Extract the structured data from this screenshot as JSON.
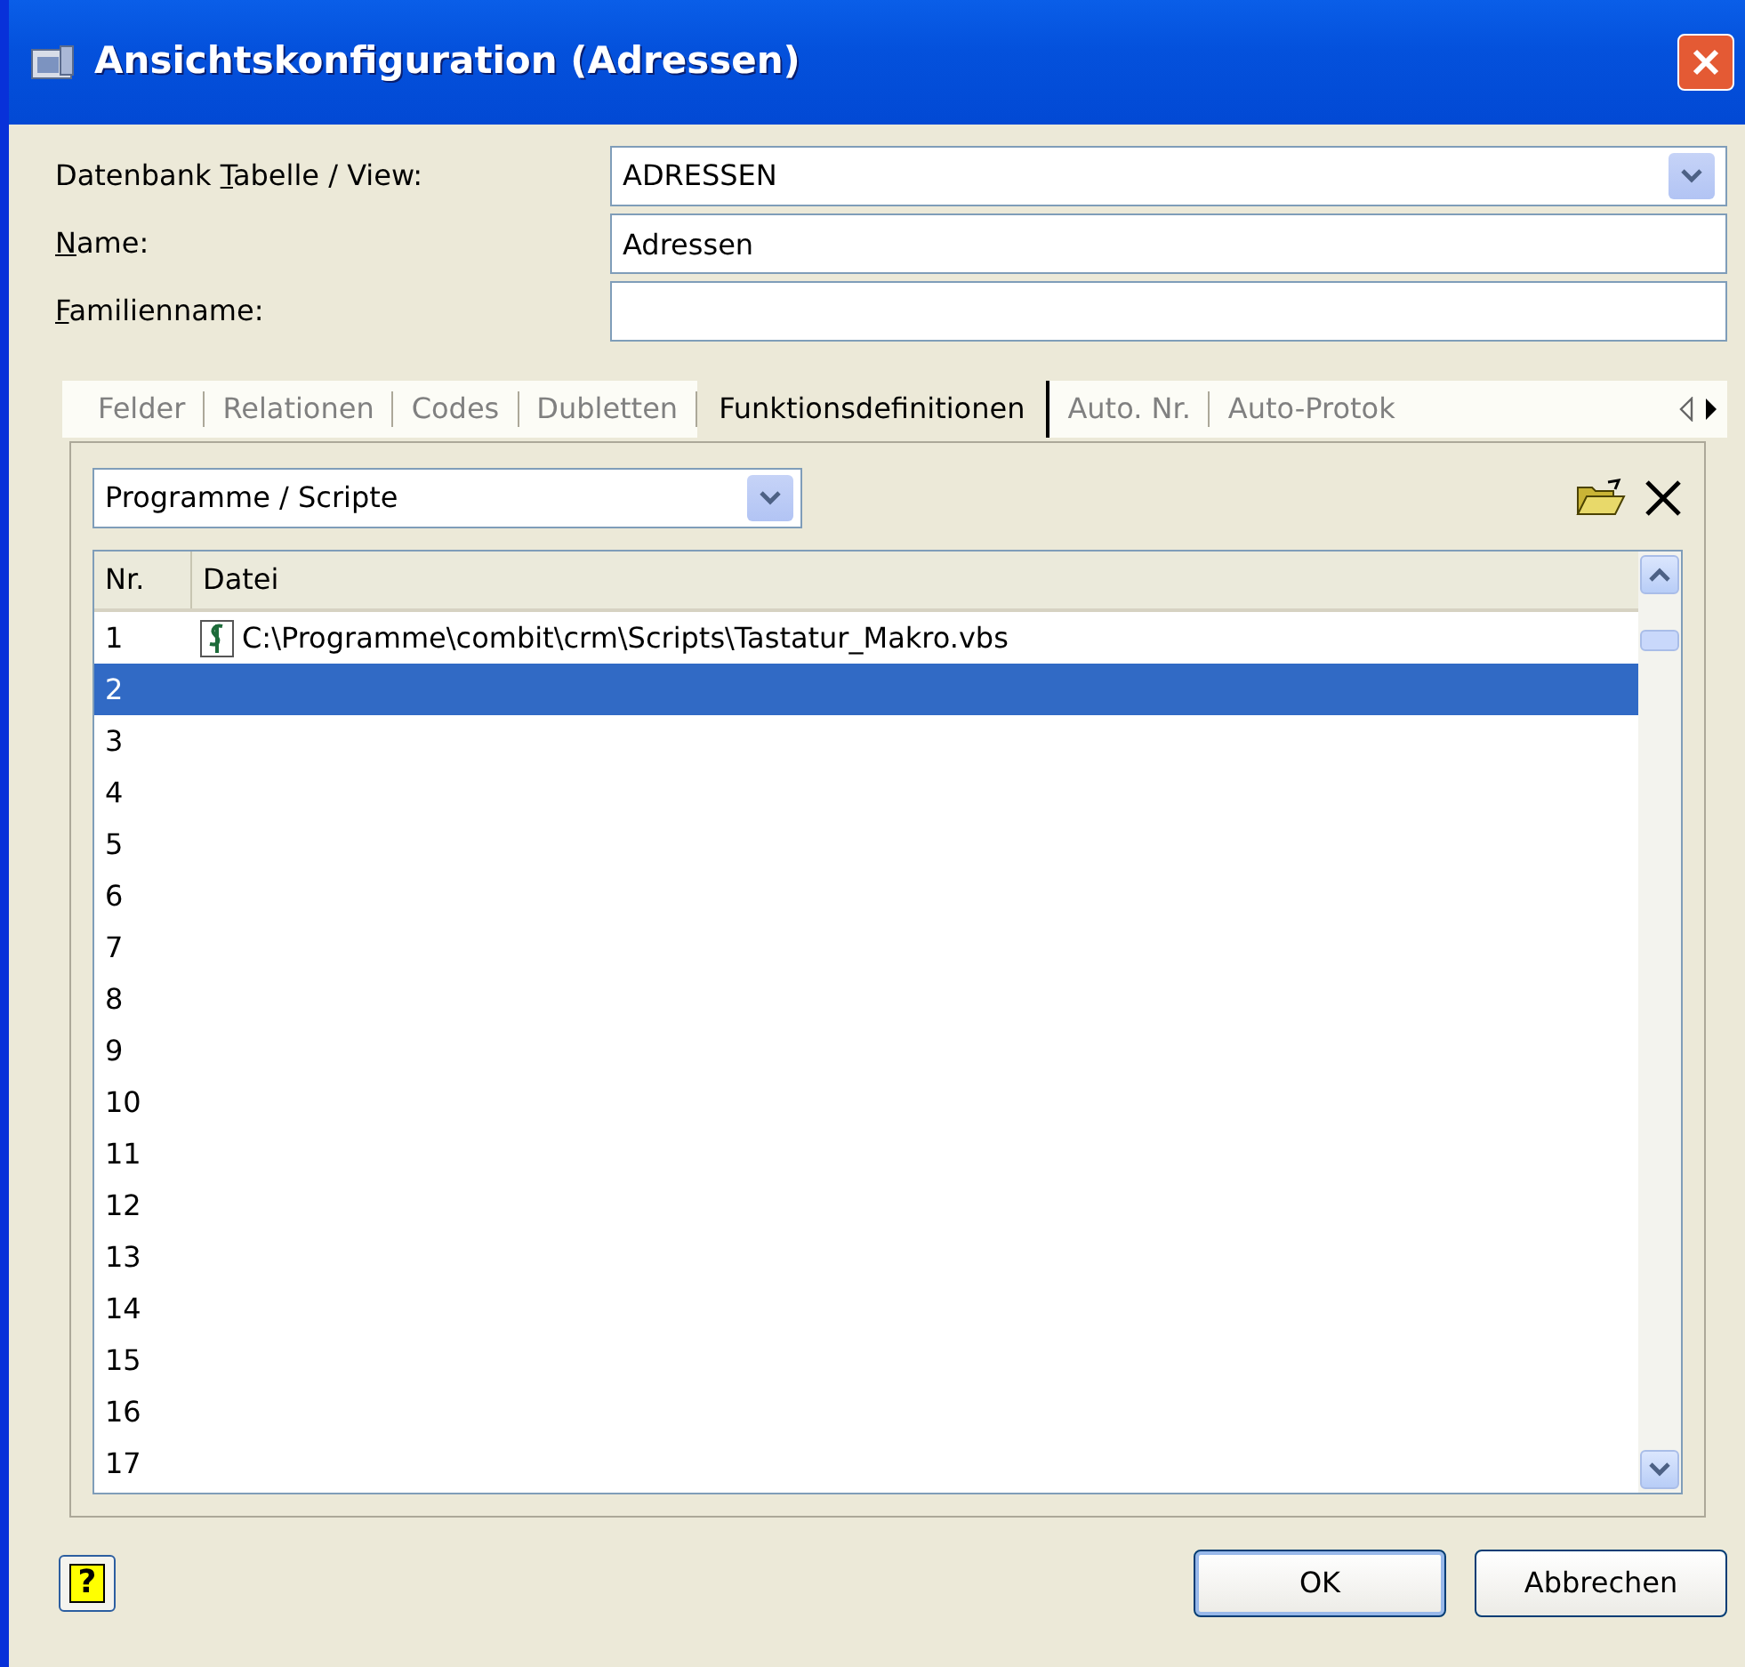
{
  "window": {
    "title": "Ansichtskonfiguration (Adressen)"
  },
  "form": [
    {
      "kind": "combo",
      "label": {
        "prefix": "Datenbank ",
        "access_key": "T",
        "suffix": "abelle / View:"
      },
      "value": "ADRESSEN"
    },
    {
      "kind": "text",
      "label": {
        "access_key": "N",
        "suffix": "ame:"
      },
      "value": "Adressen"
    },
    {
      "kind": "text",
      "label": {
        "access_key": "F",
        "suffix": "amilienname:"
      }
    }
  ],
  "tabs": [
    {
      "label": "Felder",
      "selected": false
    },
    {
      "label": "Relationen",
      "selected": false
    },
    {
      "label": "Codes",
      "selected": false
    },
    {
      "label": "Dubletten",
      "selected": false
    },
    {
      "label": "Funktionsdefinitionen",
      "selected": true
    },
    {
      "label": "Auto. Nr.",
      "selected": false
    },
    {
      "label": "Auto-Protok",
      "selected": false
    }
  ],
  "panel": {
    "category": "Programme / Scripte",
    "table": {
      "columns": [
        "Nr.",
        "Datei"
      ],
      "rows": [
        {
          "nr": "1",
          "file": "C:\\Programme\\combit\\crm\\Scripts\\Tastatur_Makro.vbs",
          "selected": false
        },
        {
          "nr": "2",
          "selected": true
        },
        {
          "nr": "3",
          "selected": false
        },
        {
          "nr": "4",
          "selected": false
        },
        {
          "nr": "5",
          "selected": false
        },
        {
          "nr": "6",
          "selected": false
        },
        {
          "nr": "7",
          "selected": false
        },
        {
          "nr": "8",
          "selected": false
        },
        {
          "nr": "9",
          "selected": false
        },
        {
          "nr": "10",
          "selected": false
        },
        {
          "nr": "11",
          "selected": false
        },
        {
          "nr": "12",
          "selected": false
        },
        {
          "nr": "13",
          "selected": false
        },
        {
          "nr": "14",
          "selected": false
        },
        {
          "nr": "15",
          "selected": false
        },
        {
          "nr": "16",
          "selected": false
        },
        {
          "nr": "17",
          "selected": false
        }
      ]
    }
  },
  "help_button": "?",
  "buttons": [
    "OK",
    "Abbrechen"
  ]
}
